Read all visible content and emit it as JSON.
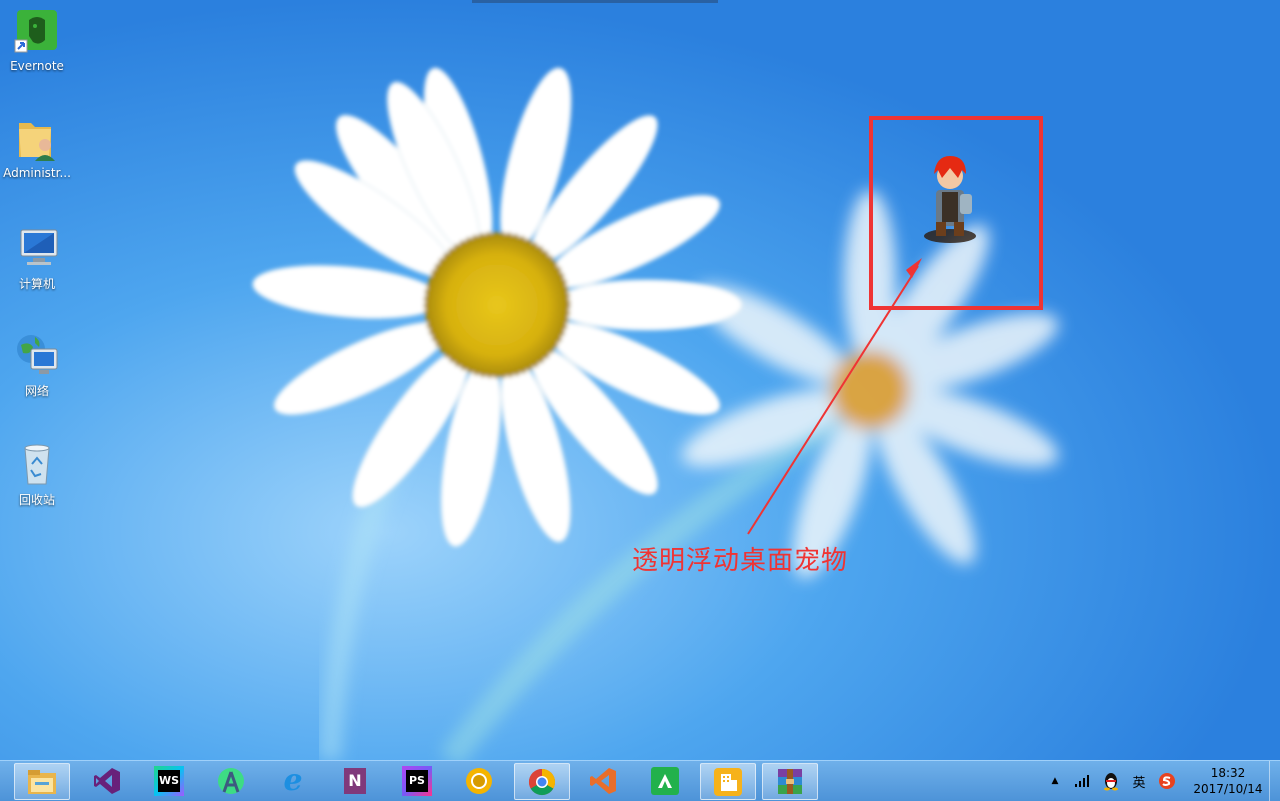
{
  "desktop_icons": [
    {
      "label": "Evernote",
      "icon": "evernote-icon"
    },
    {
      "label": "Administr...",
      "icon": "user-folder-icon"
    },
    {
      "label": "计算机",
      "icon": "computer-icon"
    },
    {
      "label": "网络",
      "icon": "network-icon"
    },
    {
      "label": "回收站",
      "icon": "recycle-bin-icon"
    }
  ],
  "annotation": {
    "text": "透明浮动桌面宠物",
    "color": "#ef3434"
  },
  "taskbar": {
    "apps": [
      {
        "name": "file-explorer",
        "icon": "folder-icon",
        "active": true
      },
      {
        "name": "visual-studio",
        "icon": "visual-studio-icon",
        "active": false
      },
      {
        "name": "webstorm",
        "icon": "webstorm-icon",
        "text": "WS",
        "active": false
      },
      {
        "name": "android-studio",
        "icon": "android-studio-icon",
        "active": false
      },
      {
        "name": "internet-explorer",
        "icon": "ie-icon",
        "text": "e",
        "active": false
      },
      {
        "name": "onenote",
        "icon": "onenote-icon",
        "text": "N",
        "active": false
      },
      {
        "name": "phpstorm",
        "icon": "phpstorm-icon",
        "text": "PS",
        "active": false
      },
      {
        "name": "chrome-canary",
        "icon": "chrome-canary-icon",
        "active": false
      },
      {
        "name": "chrome",
        "icon": "chrome-icon",
        "active": true
      },
      {
        "name": "vscode",
        "icon": "vscode-icon",
        "active": false
      },
      {
        "name": "app-green",
        "icon": "green-app-icon",
        "active": false
      },
      {
        "name": "app-building",
        "icon": "building-icon",
        "active": true
      },
      {
        "name": "winrar",
        "icon": "winrar-icon",
        "active": true
      }
    ],
    "tray": {
      "ime": "英",
      "date": "2017/10/14",
      "time": "18:32"
    }
  }
}
